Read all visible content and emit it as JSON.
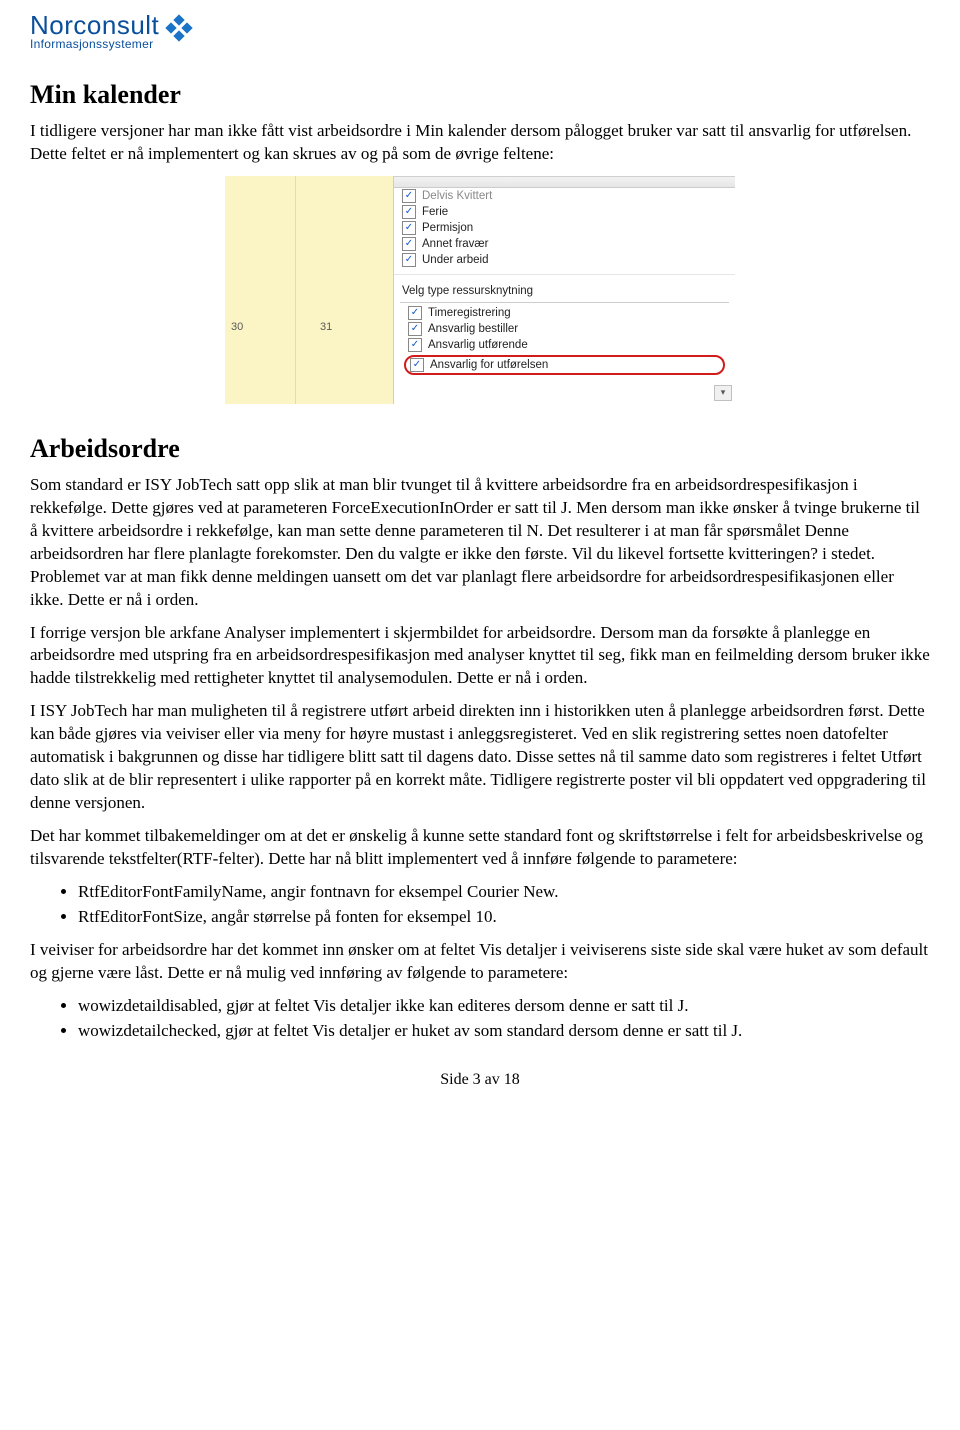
{
  "logo": {
    "brand": "Norconsult",
    "sub": "Informasjonssystemer"
  },
  "section1": {
    "heading": "Min kalender",
    "p1": "I tidligere versjoner har man ikke fått vist arbeidsordre i Min kalender dersom pålogget bruker var satt til ansvarlig for utførelsen. Dette feltet er nå implementert og kan skrues av og på som de øvrige feltene:"
  },
  "screenshot": {
    "cal_a": "30",
    "cal_b": "31",
    "checks_top": [
      "Delvis Kvittert",
      "Ferie",
      "Permisjon",
      "Annet fravær",
      "Under arbeid"
    ],
    "group_label": "Velg type ressursknytning",
    "checks_group": [
      "Timeregistrering",
      "Ansvarlig bestiller",
      "Ansvarlig utførende"
    ],
    "highlighted": "Ansvarlig for utførelsen"
  },
  "section2": {
    "heading": "Arbeidsordre",
    "p1": "Som standard er ISY JobTech satt opp slik at man blir tvunget til å kvittere arbeidsordre fra en arbeidsordrespesifikasjon i rekkefølge. Dette gjøres ved at parameteren ForceExecutionInOrder er satt til J. Men dersom man ikke ønsker å tvinge brukerne til å kvittere arbeidsordre i rekkefølge, kan man sette denne parameteren til N. Det resulterer i at man får spørsmålet Denne arbeidsordren har flere planlagte forekomster. Den du valgte er ikke den første. Vil du likevel fortsette kvitteringen? i stedet. Problemet var at man fikk denne meldingen uansett om det var planlagt flere arbeidsordre for arbeidsordrespesifikasjonen eller ikke. Dette er nå i orden.",
    "p2": "I forrige versjon ble arkfane Analyser implementert i skjermbildet for arbeidsordre. Dersom man da forsøkte å planlegge en arbeidsordre med utspring fra en arbeidsordrespesifikasjon med analyser knyttet til seg, fikk man en feilmelding dersom bruker ikke hadde tilstrekkelig med rettigheter knyttet til analysemodulen. Dette er nå i orden.",
    "p3": "I ISY JobTech har man muligheten til å registrere utført arbeid direkten inn i historikken uten å planlegge arbeidsordren først. Dette kan både gjøres via veiviser eller via meny for høyre mustast i anleggsregisteret. Ved en slik registrering settes noen datofelter automatisk i bakgrunnen og disse har tidligere blitt satt til dagens dato. Disse settes nå til samme dato som registreres i feltet Utført dato slik at de blir representert i ulike rapporter på en korrekt måte. Tidligere registrerte poster vil bli oppdatert ved oppgradering til denne versjonen.",
    "p4": "Det har kommet tilbakemeldinger om at det er ønskelig å kunne sette standard font og skriftstørrelse i felt for arbeidsbeskrivelse og tilsvarende tekstfelter(RTF-felter). Dette har nå blitt implementert ved å innføre følgende to parametere:",
    "bullets1": [
      "RtfEditorFontFamilyName, angir fontnavn for eksempel Courier New.",
      "RtfEditorFontSize, angår størrelse på fonten for eksempel 10."
    ],
    "p5": "I veiviser for arbeidsordre har det kommet inn ønsker om at feltet Vis detaljer i veiviserens siste side skal være huket av som default og gjerne være låst. Dette er nå mulig ved innføring av følgende to parametere:",
    "bullets2": [
      "wowizdetaildisabled, gjør at feltet Vis detaljer ikke kan editeres dersom denne er satt til J.",
      "wowizdetailchecked, gjør at feltet Vis detaljer er huket av som standard dersom denne er satt til J."
    ]
  },
  "footer": {
    "text": "Side 3 av 18"
  }
}
